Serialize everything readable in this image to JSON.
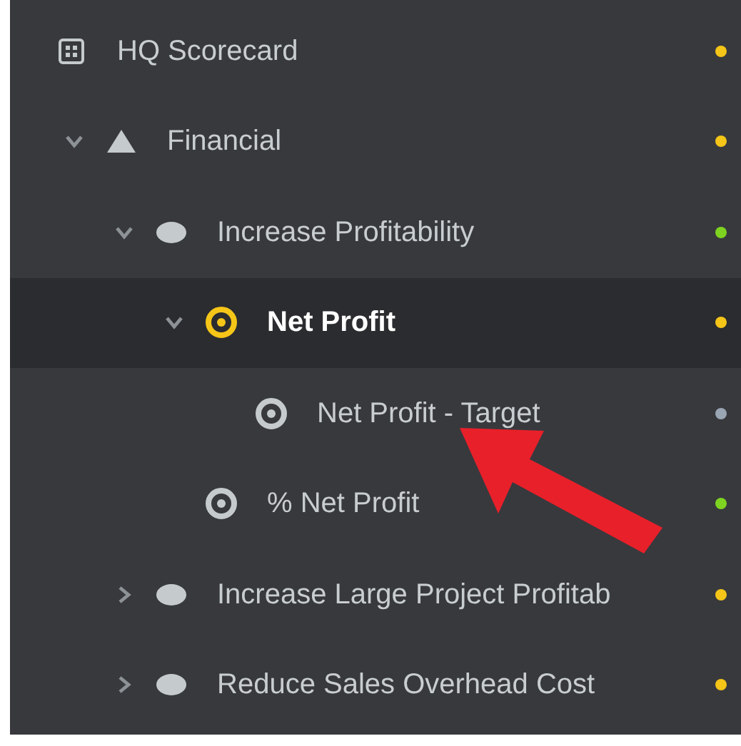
{
  "tree": [
    {
      "label": "HQ Scorecard",
      "kind": "scorecard",
      "selected": false,
      "color": "#f5c518",
      "children": [
        {
          "label": "Financial",
          "kind": "perspective",
          "expandable": true,
          "expanded": true,
          "selected": false,
          "color": "#f5c518",
          "children": [
            {
              "label": "Increase Profitability",
              "kind": "objective",
              "expandable": true,
              "expanded": true,
              "selected": false,
              "color": "#7ed321",
              "children": [
                {
                  "label": "Net Profit",
                  "kind": "measure",
                  "expandable": true,
                  "expanded": true,
                  "selected": true,
                  "color": "#f5c518",
                  "children": [
                    {
                      "label": "Net Profit - Target",
                      "kind": "measure",
                      "expandable": false,
                      "selected": false,
                      "color": "#9ba6b4"
                    }
                  ]
                },
                {
                  "label": "% Net Profit",
                  "kind": "measure",
                  "expandable": false,
                  "selected": false,
                  "color": "#7ed321"
                }
              ]
            },
            {
              "label": "Increase Large Project Profitab",
              "kind": "objective",
              "expandable": true,
              "expanded": false,
              "selected": false,
              "color": "#f5c518"
            },
            {
              "label": "Reduce Sales Overhead Cost",
              "kind": "objective",
              "expandable": true,
              "expanded": false,
              "selected": false,
              "color": "#f5c518"
            }
          ]
        }
      ]
    }
  ]
}
